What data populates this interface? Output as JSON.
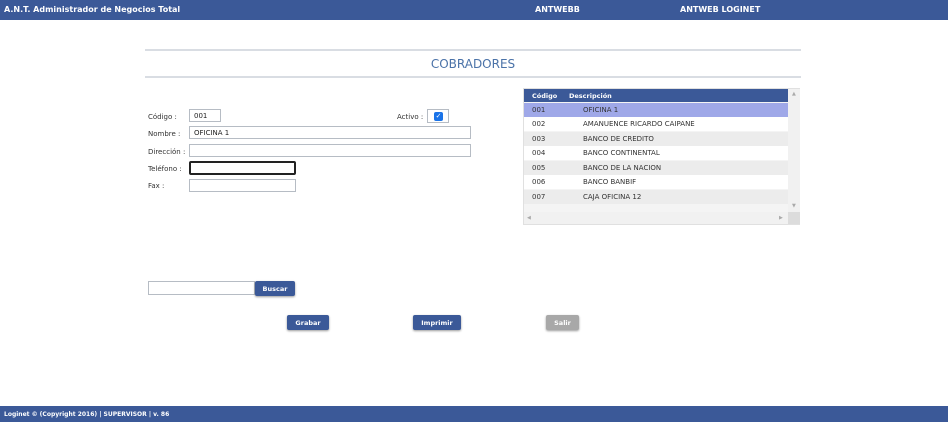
{
  "header": {
    "app_title": "A.N.T. Administrador de Negocios Total",
    "company": "ANTWEBB",
    "system": "ANTWEB LOGINET"
  },
  "page": {
    "title": "COBRADORES"
  },
  "form": {
    "codigo_label": "Código :",
    "codigo_value": "001",
    "activo_label": "Activo :",
    "activo_checked": true,
    "nombre_label": "Nombre :",
    "nombre_value": "OFICINA 1",
    "direccion_label": "Dirección :",
    "direccion_value": "",
    "telefono_label": "Teléfono :",
    "telefono_value": "",
    "fax_label": "Fax :",
    "fax_value": ""
  },
  "grid": {
    "columns": [
      "Código",
      "Descripción"
    ],
    "rows": [
      {
        "codigo": "001",
        "descripcion": "OFICINA 1"
      },
      {
        "codigo": "002",
        "descripcion": "AMANUENCE RICARDO CAIPANE"
      },
      {
        "codigo": "003",
        "descripcion": "BANCO DE CREDITO"
      },
      {
        "codigo": "004",
        "descripcion": "BANCO CONTINENTAL"
      },
      {
        "codigo": "005",
        "descripcion": "BANCO DE LA NACION"
      },
      {
        "codigo": "006",
        "descripcion": "BANCO BANBIF"
      },
      {
        "codigo": "007",
        "descripcion": "CAJA OFICINA 12"
      }
    ],
    "selected_index": 0
  },
  "search": {
    "value": "",
    "button_label": "Buscar"
  },
  "actions": {
    "save_label": "Grabar",
    "print_label": "Imprimir",
    "exit_label": "Salir"
  },
  "footer": {
    "text": "Loginet © (Copyright 2016) | SUPERVISOR | v. 86"
  },
  "colors": {
    "brand": "#3b5998",
    "selected_row": "#9fa8e8",
    "title": "#4a72a8",
    "disabled": "#a8a8a8"
  },
  "icons": {
    "checkbox": "checkmark-icon",
    "scroll_up": "triangle-up-icon",
    "scroll_down": "triangle-down-icon",
    "scroll_left": "triangle-left-icon",
    "scroll_right": "triangle-right-icon"
  }
}
